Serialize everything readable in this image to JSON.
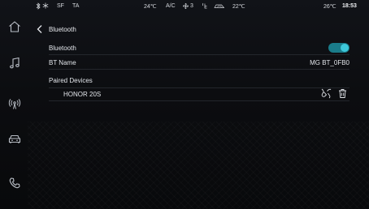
{
  "status_bar": {
    "indicators": [
      "bluetooth-icon",
      "star-icon"
    ],
    "sf": "SF",
    "ta": "TA",
    "temp_left": "24℃",
    "ac": "A/C",
    "fan_level": "3",
    "temp_right": "22℃",
    "outside_temp": "26℃",
    "time": "18:53"
  },
  "sidebar": {
    "items": [
      {
        "icon": "home-icon"
      },
      {
        "icon": "music-icon"
      },
      {
        "icon": "radio-icon"
      },
      {
        "icon": "car-icon"
      },
      {
        "icon": "phone-icon"
      }
    ]
  },
  "page": {
    "title": "Bluetooth"
  },
  "settings": {
    "bluetooth_label": "Bluetooth",
    "bluetooth_enabled": true,
    "bt_name_label": "BT Name",
    "bt_name_value": "MG BT_0FB0",
    "paired_devices_label": "Paired Devices"
  },
  "paired_devices": [
    {
      "name": "HONOR 20S"
    }
  ],
  "colors": {
    "accent": "#3ec8da",
    "toggle_track": "#1a7c8a",
    "background": "#0c0d10"
  }
}
